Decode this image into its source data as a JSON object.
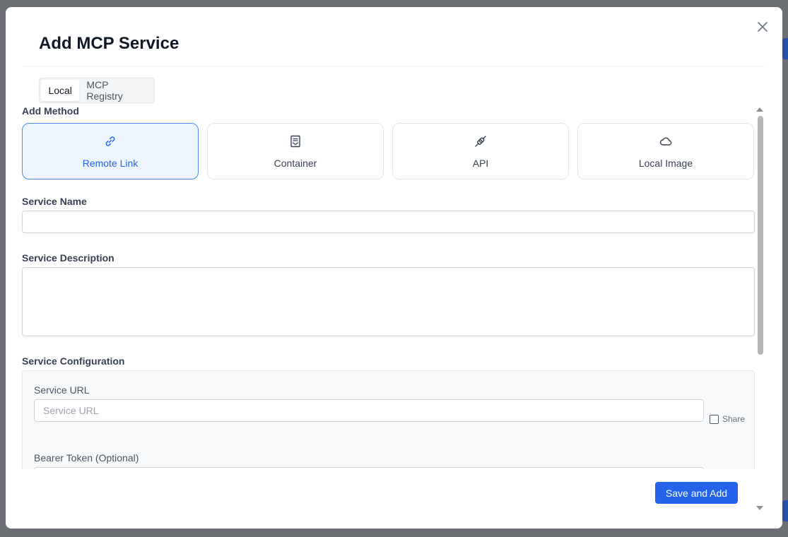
{
  "dialog": {
    "title": "Add MCP Service",
    "close_icon": "close-icon"
  },
  "tabs": [
    {
      "label": "Local",
      "active": true
    },
    {
      "label": "MCP Registry",
      "active": false
    }
  ],
  "add_method": {
    "label": "Add Method",
    "options": [
      {
        "label": "Remote Link",
        "icon": "link-icon",
        "selected": true
      },
      {
        "label": "Container",
        "icon": "container-icon",
        "selected": false
      },
      {
        "label": "API",
        "icon": "plug-icon",
        "selected": false
      },
      {
        "label": "Local Image",
        "icon": "cloud-icon",
        "selected": false
      }
    ]
  },
  "service_name": {
    "label": "Service Name",
    "value": ""
  },
  "service_description": {
    "label": "Service Description",
    "value": ""
  },
  "service_configuration": {
    "label": "Service Configuration",
    "service_url": {
      "label": "Service URL",
      "placeholder": "Service URL",
      "value": ""
    },
    "share": {
      "label": "Share",
      "checked": false
    },
    "bearer_token": {
      "label": "Bearer Token (Optional)"
    }
  },
  "footer": {
    "save_label": "Save and Add"
  },
  "colors": {
    "primary": "#2563eb",
    "selected_bg": "#eef5ff",
    "selected_border": "#4a8cf0"
  }
}
